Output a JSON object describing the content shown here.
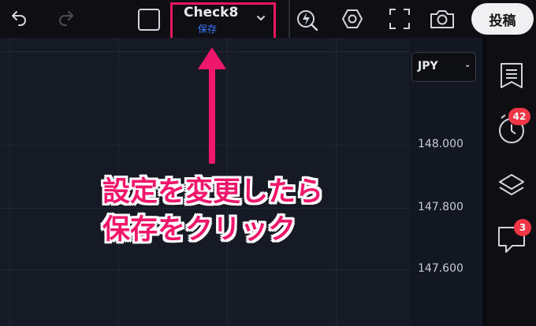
{
  "toolbar": {
    "layout_name": "Check8",
    "save_label": "保存",
    "post_label": "投稿",
    "icons": [
      "undo-icon",
      "redo-icon",
      "square-icon",
      "chevron-down-icon",
      "alert-lightning-icon",
      "settings-hexagon-icon",
      "fullscreen-icon",
      "camera-icon"
    ]
  },
  "chart": {
    "currency": "JPY",
    "price_labels": [
      "148.000",
      "147.800",
      "147.600"
    ]
  },
  "sidebar": {
    "alerts_badge": "42",
    "chat_badge": "3",
    "icons": [
      "watchlist-icon",
      "alerts-clock-icon",
      "layers-icon",
      "chat-icon"
    ]
  },
  "annotation": {
    "line1": "設定を変更したら",
    "line2": "保存をクリック"
  },
  "colors": {
    "highlight": "#e8195c",
    "save_text": "#3a7bff",
    "badge": "#f23645",
    "annotation": "#f0166b"
  }
}
